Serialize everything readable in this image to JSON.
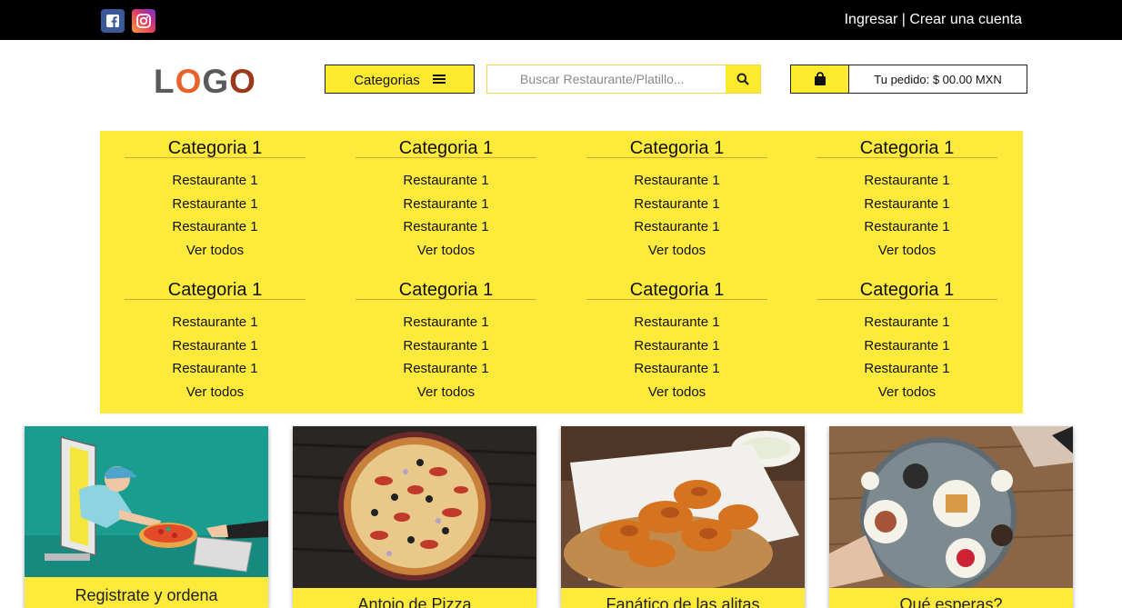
{
  "topbar": {
    "login_label": "Ingresar",
    "separator": "|",
    "register_label": "Crear una cuenta"
  },
  "header": {
    "logo": {
      "l": "L",
      "o": "O",
      "g": "G",
      "o2": "O"
    },
    "categories_button": "Categorias",
    "search_placeholder": "Buscar Restaurante/Platillo...",
    "cart_total": "Tu pedido: $ 00.00 MXN"
  },
  "menu": {
    "columns": [
      {
        "title": "Categoria 1",
        "items": [
          "Restaurante 1",
          "Restaurante 1",
          "Restaurante 1"
        ],
        "see_all": "Ver todos"
      },
      {
        "title": "Categoria 1",
        "items": [
          "Restaurante 1",
          "Restaurante 1",
          "Restaurante 1"
        ],
        "see_all": "Ver todos"
      },
      {
        "title": "Categoria 1",
        "items": [
          "Restaurante 1",
          "Restaurante 1",
          "Restaurante 1"
        ],
        "see_all": "Ver todos"
      },
      {
        "title": "Categoria 1",
        "items": [
          "Restaurante 1",
          "Restaurante 1",
          "Restaurante 1"
        ],
        "see_all": "Ver todos"
      },
      {
        "title": "Categoria 1",
        "items": [
          "Restaurante 1",
          "Restaurante 1",
          "Restaurante 1"
        ],
        "see_all": "Ver todos"
      },
      {
        "title": "Categoria 1",
        "items": [
          "Restaurante 1",
          "Restaurante 1",
          "Restaurante 1"
        ],
        "see_all": "Ver todos"
      },
      {
        "title": "Categoria 1",
        "items": [
          "Restaurante 1",
          "Restaurante 1",
          "Restaurante 1"
        ],
        "see_all": "Ver todos"
      },
      {
        "title": "Categoria 1",
        "items": [
          "Restaurante 1",
          "Restaurante 1",
          "Restaurante 1"
        ],
        "see_all": "Ver todos"
      }
    ]
  },
  "cards": [
    {
      "caption": "Registrate y ordena",
      "icon": "delivery-illustration"
    },
    {
      "caption": "Antojo de Pizza",
      "icon": "pizza-photo"
    },
    {
      "caption": "Fanático de las alitas",
      "icon": "chicken-wings-photo"
    },
    {
      "caption": "Qué esperas?",
      "icon": "breakfast-table-photo"
    }
  ],
  "colors": {
    "accent_yellow": "#fdea3b",
    "topbar": "#000000",
    "facebook": "#3b5998"
  }
}
